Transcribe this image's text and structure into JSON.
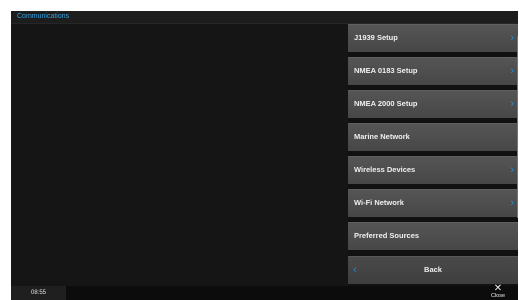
{
  "window": {
    "title": "Communications"
  },
  "menu": {
    "items": [
      {
        "label": "J1939 Setup",
        "has_chevron": true
      },
      {
        "label": "NMEA 0183 Setup",
        "has_chevron": true
      },
      {
        "label": "NMEA 2000 Setup",
        "has_chevron": true
      },
      {
        "label": "Marine Network",
        "has_chevron": false
      },
      {
        "label": "Wireless Devices",
        "has_chevron": true
      },
      {
        "label": "Wi-Fi Network",
        "has_chevron": true
      },
      {
        "label": "Preferred Sources",
        "has_chevron": false
      }
    ],
    "chevron_glyph": "›",
    "back_label": "Back",
    "back_glyph": "‹"
  },
  "statusbar": {
    "time": "08:55",
    "close_glyph": "✕",
    "close_label": "Close"
  },
  "colors": {
    "accent": "#1e8fd8",
    "title_text": "#2fa3e6",
    "background": "#151515",
    "button": "#4e4e4e"
  }
}
